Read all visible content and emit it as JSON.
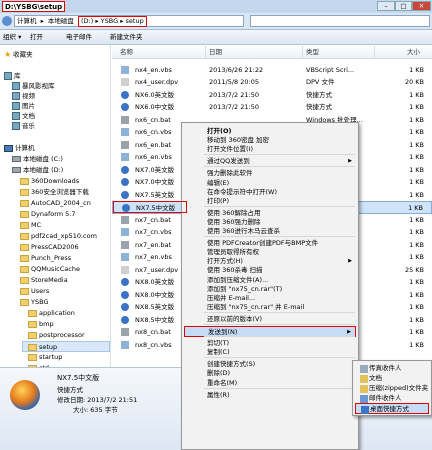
{
  "window": {
    "title": "D:\\YSBG\\setup",
    "controls": [
      "–",
      "□",
      "✕"
    ]
  },
  "address": {
    "crumbs": [
      "计算机",
      "本地磁盘"
    ],
    "highlighted": "(D:) ▸ YSBG ▸ setup"
  },
  "commandbar": {
    "items": [
      "组织 ▾",
      "打开",
      "电子邮件",
      "新建文件夹"
    ]
  },
  "nav": {
    "favorites": "收藏夹",
    "libraries": "库",
    "lib_items": [
      "暴风影视库",
      "视频",
      "图片",
      "文档",
      "音乐"
    ],
    "computer": "计算机",
    "drives": [
      "本地磁盘 (C:)",
      "本地磁盘 (D:)"
    ],
    "folders": [
      "360Downloads",
      "360安全浏览器下载",
      "AutoCAD_2004_cn",
      "Dynaform 5.7",
      "MC",
      "pdf2cad_xp510.com",
      "PressCAD2006",
      "Punch_Press",
      "QQMusicCache",
      "StoreMedia",
      "Users",
      "YSBG"
    ],
    "subfolders": [
      "application",
      "bmp",
      "postprocessor",
      "setup",
      "startup",
      "std"
    ]
  },
  "columns": {
    "name": "名称",
    "date": "日期",
    "type": "类型",
    "size": "大小"
  },
  "files": [
    {
      "name": "nx4_en.vbs",
      "date": "2013/6/26 21:22",
      "type": "VBScript Scri...",
      "size": "1 KB",
      "icon": "script"
    },
    {
      "name": "nx4_user.dpv",
      "date": "2011/5/8 20:05",
      "type": "DPV 文件",
      "size": "20 KB",
      "icon": "doc"
    },
    {
      "name": "NX6.0英文版",
      "date": "2013/7/2 21:50",
      "type": "快捷方式",
      "size": "1 KB",
      "icon": "nx"
    },
    {
      "name": "NX6.0中文版",
      "date": "2013/7/2 21:50",
      "type": "快捷方式",
      "size": "1 KB",
      "icon": "nx"
    },
    {
      "name": "nx6_cn.bat",
      "date": "",
      "type": "Windows 批处理...",
      "size": "1 KB",
      "icon": "bat"
    },
    {
      "name": "nx6_cn.vbs",
      "date": "",
      "type": "Script Scri...",
      "size": "1 KB",
      "icon": "script"
    },
    {
      "name": "nx6_en.bat",
      "date": "",
      "type": "lows 批处理...",
      "size": "1 KB",
      "icon": "bat"
    },
    {
      "name": "nx6_en.vbs",
      "date": "",
      "type": "Script Scri...",
      "size": "1 KB",
      "icon": "script"
    },
    {
      "name": "NX7.0英文版",
      "date": "",
      "type": "方式",
      "size": "1 KB",
      "icon": "nx"
    },
    {
      "name": "NX7.0中文版",
      "date": "",
      "type": "方式",
      "size": "1 KB",
      "icon": "nx"
    },
    {
      "name": "NX7.5英文版",
      "date": "",
      "type": "方式",
      "size": "1 KB",
      "icon": "nx"
    },
    {
      "name": "NX7.5中文版",
      "date": "",
      "type": "",
      "size": "1 KB",
      "icon": "nx"
    },
    {
      "name": "nx7_cn.bat",
      "date": "",
      "type": "ows 批处理...",
      "size": "1 KB",
      "icon": "bat"
    },
    {
      "name": "nx7_cn.vbs",
      "date": "",
      "type": "Script Scri...",
      "size": "1 KB",
      "icon": "script"
    },
    {
      "name": "nx7_en.bat",
      "date": "",
      "type": "ows 批处理...",
      "size": "1 KB",
      "icon": "bat"
    },
    {
      "name": "nx7_en.vbs",
      "date": "",
      "type": "Script Scri...",
      "size": "1 KB",
      "icon": "script"
    },
    {
      "name": "nx7_user.dpv",
      "date": "",
      "type": "",
      "size": "25 KB",
      "icon": "doc"
    },
    {
      "name": "NX8.0英文版",
      "date": "",
      "type": "方式",
      "size": "1 KB",
      "icon": "nx"
    },
    {
      "name": "NX8.0中文版",
      "date": "",
      "type": "方式",
      "size": "1 KB",
      "icon": "nx"
    },
    {
      "name": "NX8.5英文版",
      "date": "",
      "type": "方式",
      "size": "1 KB",
      "icon": "nx"
    },
    {
      "name": "NX8.5中文版",
      "date": "",
      "type": "方式",
      "size": "1 KB",
      "icon": "nx"
    },
    {
      "name": "nx8_cn.bat",
      "date": "",
      "type": "ows 批处理...",
      "size": "1 KB",
      "icon": "bat"
    },
    {
      "name": "nx8_cn.vbs",
      "date": "",
      "type": "ipt Scri...",
      "size": "1 KB",
      "icon": "script"
    }
  ],
  "context_menu": {
    "items": [
      {
        "label": "打开(O)",
        "bold": true
      },
      {
        "label": "移动到 360密盘 加密"
      },
      {
        "label": "打开文件位置(I)"
      },
      {
        "sep": true
      },
      {
        "label": "通过QQ发送到",
        "arrow": true
      },
      {
        "sep": true
      },
      {
        "label": "强力删除此软件"
      },
      {
        "label": "编辑(E)"
      },
      {
        "label": "在命令提示符中打开(W)"
      },
      {
        "label": "打印(P)"
      },
      {
        "sep": true
      },
      {
        "label": "使用 360解除占用"
      },
      {
        "label": "使用 360强力删除"
      },
      {
        "label": "使用 360进行木马云查杀"
      },
      {
        "sep": true
      },
      {
        "label": "使用 PDFCreator创建PDF与BMP文件"
      },
      {
        "label": "管理员取得所有权"
      },
      {
        "label": "打开方式(H)",
        "arrow": true
      },
      {
        "label": "使用 360杀毒 扫描"
      },
      {
        "label": "添加到压缩文件(A)..."
      },
      {
        "label": "添加到 \"nx75_cn.rar\"(T)"
      },
      {
        "label": "压缩并 E-mail..."
      },
      {
        "label": "压缩到 \"nx75_cn.rar\" 并 E-mail"
      },
      {
        "sep": true
      },
      {
        "label": "还原以前的版本(V)"
      },
      {
        "sep": true
      },
      {
        "label": "发送到(N)",
        "arrow": true,
        "active": true
      },
      {
        "sep": true
      },
      {
        "label": "剪切(T)"
      },
      {
        "label": "复制(C)"
      },
      {
        "sep": true
      },
      {
        "label": "创建快捷方式(S)"
      },
      {
        "label": "删除(D)"
      },
      {
        "label": "重命名(M)"
      },
      {
        "sep": true
      },
      {
        "label": "属性(R)"
      }
    ]
  },
  "sendto_menu": {
    "items": [
      "传真收件人",
      "文档",
      "压缩(zipped)文件夹",
      "邮件收件人",
      "桌面快捷方式"
    ]
  },
  "details": {
    "name": "NX7.5中文版",
    "type": "快捷方式",
    "modified": "修改日期: 2013/7/2 21:51",
    "size": "大小: 635 字节"
  },
  "colors": {
    "highlight_red": "#dd0000",
    "selection": "#cfe3fa"
  }
}
